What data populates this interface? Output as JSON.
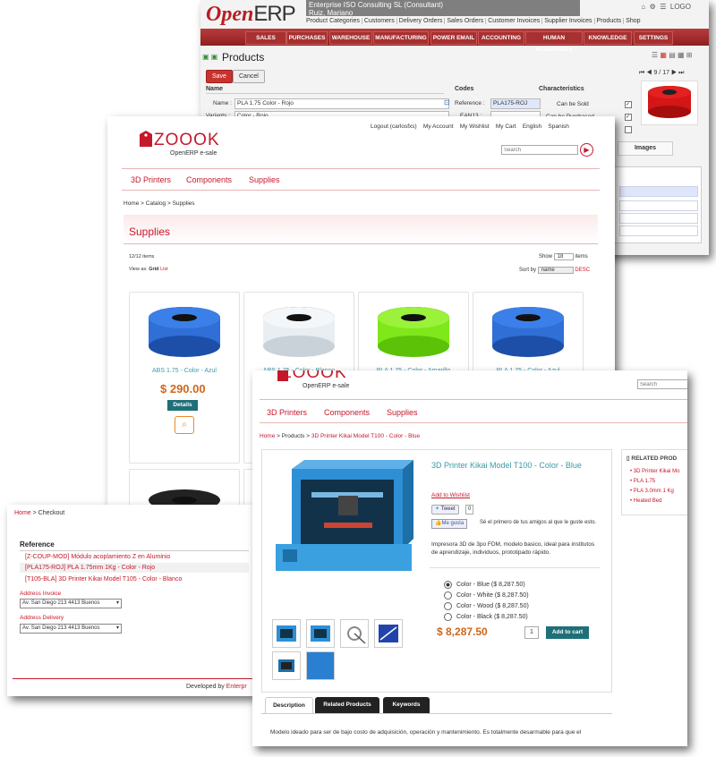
{
  "openerp": {
    "logo_open": "Open",
    "logo_erp": "ERP",
    "company_line1": "Enterprise ISO Consulting SL (Consultant)",
    "company_line2": "Ruiz, Mariano",
    "top_links": [
      "Product Categories",
      "Customers",
      "Delivery Orders",
      "Sales Orders",
      "Customer Invoices",
      "Supplier Invoices",
      "Products",
      "Shop"
    ],
    "top_right": "LOGO",
    "menu": [
      "SALES",
      "PURCHASES",
      "WAREHOUSE",
      "MANUFACTURING",
      "POWER EMAIL",
      "ACCOUNTING",
      "HUMAN RESOURCES",
      "KNOWLEDGE",
      "SETTINGS"
    ],
    "page_title": "Products",
    "save_label": "Save",
    "cancel_label": "Cancel",
    "pager": "9 / 17",
    "sections": {
      "name": "Name",
      "codes": "Codes",
      "characteristics": "Characteristics"
    },
    "name_label": "Name :",
    "name_value": "PLA 1.75 Color - Rojo",
    "variants_label": "Variants :",
    "variants_value": "Color - Rojo",
    "reference_label": "Reference :",
    "reference_value": "PLA175-ROJ",
    "ean_label": "EAN13 :",
    "can_be_sold": "Can be Sold",
    "can_be_purchased": "Can be Purchased",
    "images_tab": "Images"
  },
  "shop": {
    "brand": "ZOOOK",
    "brand_sub": "OpenERP e-sale",
    "top_links": [
      "Logout (carlosfxs)",
      "My Account",
      "My Wishlist",
      "My Cart",
      "English",
      "Spanish"
    ],
    "search_placeholder": "Search",
    "nav": [
      "3D Printers",
      "Components",
      "Supplies"
    ],
    "breadcrumb": [
      "Home",
      "Catalog",
      "Supplies"
    ],
    "page_title": "Supplies",
    "items_count": "12/12 items",
    "show_label": "Show",
    "show_value": "18",
    "items_label": "items",
    "view_as": "View as:",
    "view_grid": "Grid",
    "view_list": "List",
    "sort_by": "Sort by",
    "sort_value": "name",
    "sort_dir": "DESC",
    "products": [
      {
        "name": "ABS 1.75 - Color - Azul",
        "color": "#2f6fd6"
      },
      {
        "name": "ABS 1.75 - Color - Blanco",
        "color": "#e8eef2"
      },
      {
        "name": "PLA 1.75 - Color - Amarillo",
        "color": "#7fe81a"
      },
      {
        "name": "PLA 1.75 - Color - Azul",
        "color": "#2f6fd6"
      }
    ],
    "price": "$ 290.00",
    "details_label": "Details"
  },
  "checkout": {
    "breadcrumb_home": "Home",
    "breadcrumb_current": "Checkout",
    "reference_title": "Reference",
    "lines": [
      "[Z-COUP-MOD] Módulo acoplamiento Z en Aluminio",
      "[PLA175-ROJ] PLA 1.75mm 1Kg - Color - Rojo",
      "[T105-BLA] 3D Printer Kikai Model T105 - Color - Blanco"
    ],
    "invoice_label": "Address Invoice",
    "invoice_value": "Av. San Diego 213 4413 Buenos",
    "delivery_label": "Address Delivery",
    "delivery_value": "Av. San Diego 213 4413 Buenos",
    "footer": "Developed by",
    "footer_link": "Enterpr"
  },
  "product": {
    "brand": "ZOOOK",
    "brand_sub": "OpenERP e-sale",
    "search_placeholder": "Search",
    "nav": [
      "3D Printers",
      "Components",
      "Supplies"
    ],
    "breadcrumb": [
      "Home",
      "Products",
      "3D Printer Kikai Model T100 - Color - Blue"
    ],
    "title": "3D Printer Kikai Model T100 - Color - Blue",
    "wishlist": "Add to Wishlist",
    "tweet": "Tweet",
    "tweet_count": "0",
    "like": "Me gusta",
    "like_text": "Sé el primero de tus amigos al que le guste esto.",
    "description": "Impresora 3D de 3po FDM, modelo basico, ideal para institutos de aprendizaje, individuos, prototipado rápido.",
    "variants": [
      {
        "label": "Color - Blue ($ 8,287.50)",
        "checked": true
      },
      {
        "label": "Color - White ($ 8,287.50)",
        "checked": false
      },
      {
        "label": "Color - Wood ($ 8,287.50)",
        "checked": false
      },
      {
        "label": "Color - Black ($ 8,287.50)",
        "checked": false
      }
    ],
    "price": "$ 8,287.50",
    "qty": "1",
    "add_to_cart": "Add to cart",
    "tabs": [
      "Description",
      "Related Products",
      "Keywords"
    ],
    "long_description": "Modelo ideado para ser de bajo costo de adquisición, operación y mantenimiento. Es totalmente desarmable para que el",
    "related_title": "RELATED PROD",
    "related": [
      "3D Printer Kikai Mo",
      "PLA 1.75",
      "PLA 3.0mm 1 Kg",
      "Heated Bed"
    ]
  },
  "colors": {
    "brand_red": "#c5182b",
    "teal": "#1f6f79",
    "price_orange": "#d0661a",
    "erp_red": "#a73030"
  }
}
